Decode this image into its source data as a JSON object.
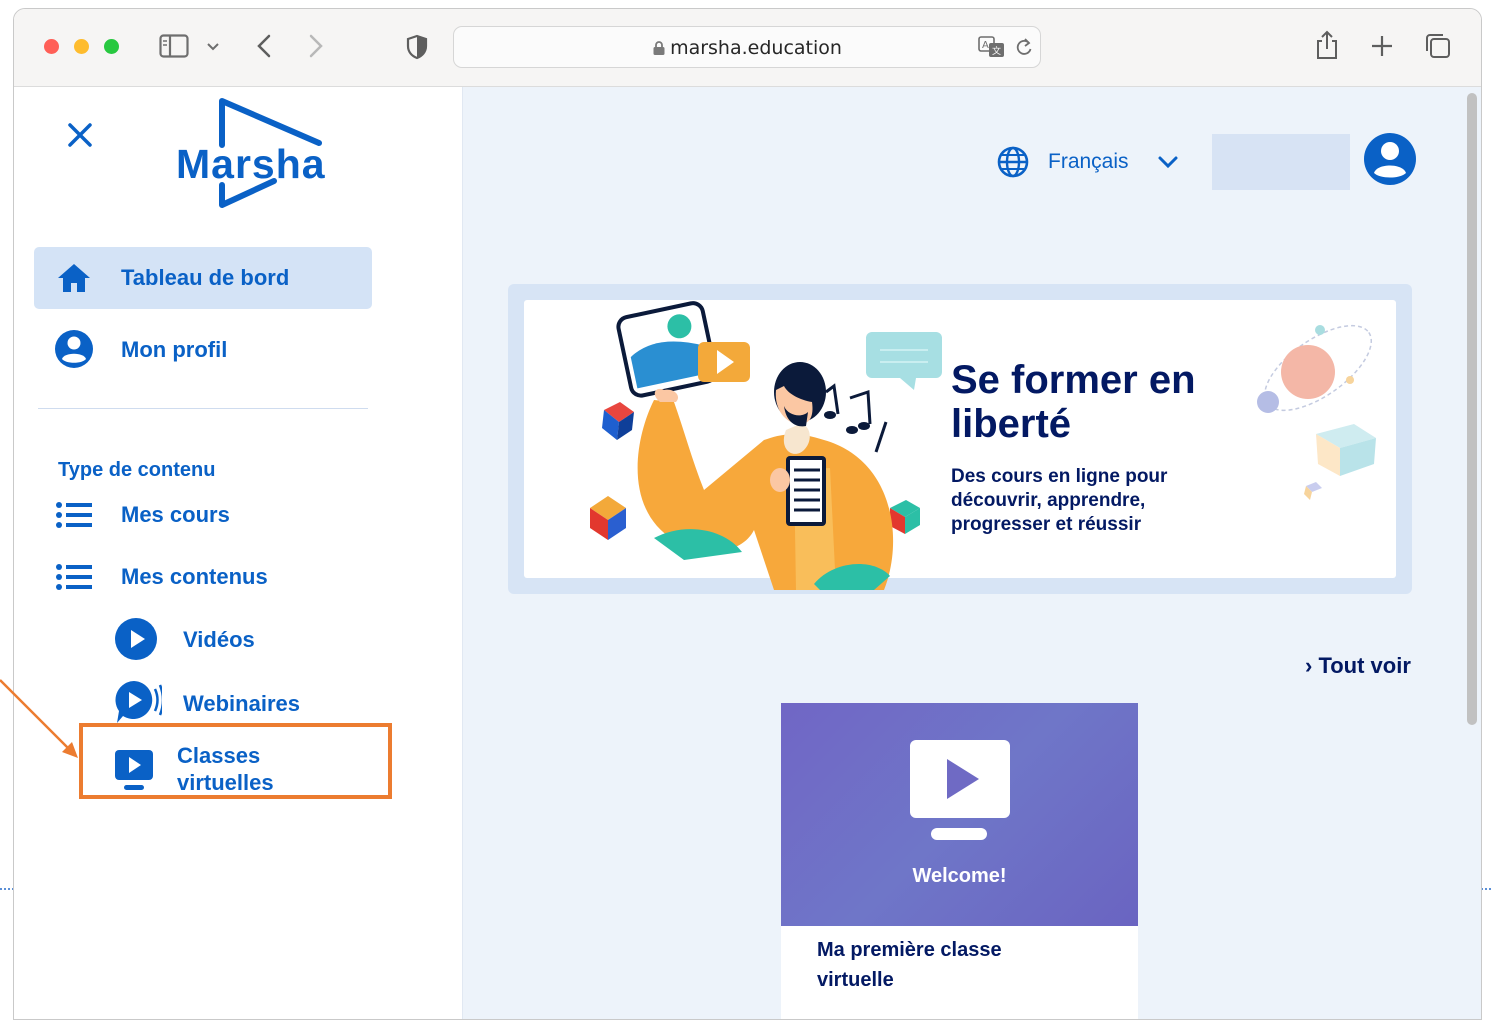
{
  "browser": {
    "url": "marsha.education"
  },
  "sidebar": {
    "logo_text": "Marsha",
    "items": [
      {
        "label": "Tableau de bord"
      },
      {
        "label": "Mon profil"
      }
    ],
    "section_title": "Type de contenu",
    "content_items": [
      {
        "label": "Mes cours"
      },
      {
        "label": "Mes contenus"
      }
    ],
    "sub_items": [
      {
        "label": "Vidéos"
      },
      {
        "label": "Webinaires"
      },
      {
        "label_line1": "Classes",
        "label_line2": "virtuelles"
      }
    ]
  },
  "header": {
    "language": "Français"
  },
  "banner": {
    "title_line1": "Se former en",
    "title_line2": "liberté",
    "subtitle_line1": "Des cours en ligne pour",
    "subtitle_line2": "découvrir, apprendre,",
    "subtitle_line3": "progresser et réussir"
  },
  "main": {
    "see_all": "› Tout voir"
  },
  "card": {
    "tag": "Welcome!",
    "title_line1": "Ma première classe",
    "title_line2": "virtuelle"
  },
  "colors": {
    "brand_blue": "#0a61c6",
    "dark_navy": "#031963",
    "highlight_orange": "#ec7c30",
    "card_purple": "#6f6ac4"
  }
}
